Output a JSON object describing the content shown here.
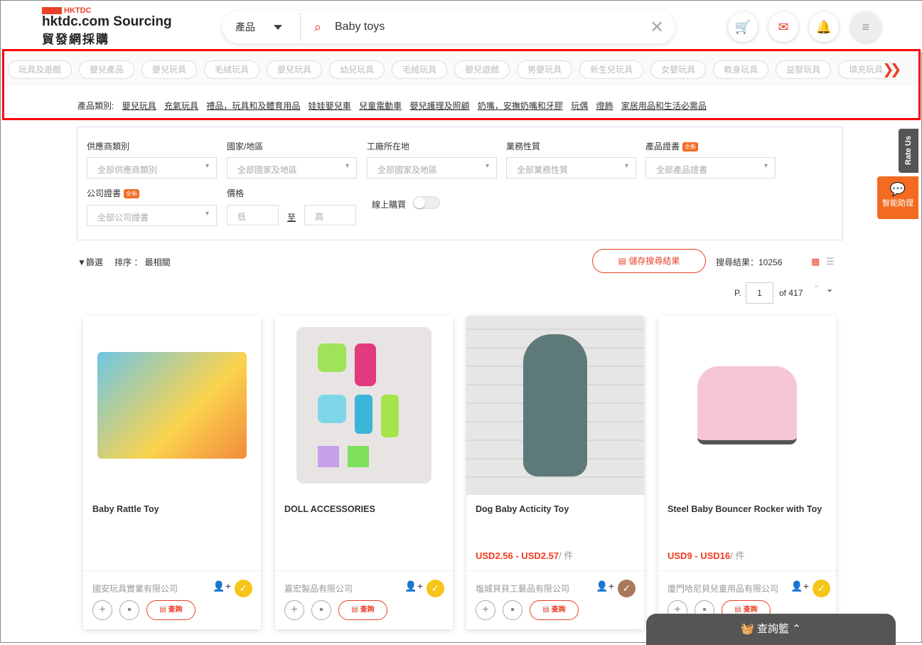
{
  "header": {
    "logo_brand": "HKTDC",
    "logo_line1": "hktdc.com Sourcing",
    "logo_line2": "貿發網採購",
    "search_category": "產品",
    "search_value": "Baby toys",
    "icons": [
      "cart-icon",
      "mail-icon",
      "bell-icon",
      "menu-icon"
    ]
  },
  "chips": [
    "玩具及遊戲",
    "嬰兒產品",
    "嬰兒玩具",
    "毛絨玩具",
    "嬰兒玩具",
    "幼兒玩具",
    "毛绒玩具",
    "嬰兒遊戲",
    "男嬰玩具",
    "新生兒玩具",
    "女嬰玩具",
    "軟身玩具",
    "益智玩具",
    "填充玩具"
  ],
  "categories": {
    "label": "產品類別:",
    "items": [
      "嬰兒玩具",
      "充氣玩具",
      "禮品，玩具和及體育用品",
      "娃娃嬰兒車",
      "兒童電動車",
      "嬰兒護理及照顧",
      "奶嘴，安撫奶嘴和牙膠",
      "玩偶",
      "燈飾",
      "家居用品和生活必需品"
    ]
  },
  "filters": {
    "new_badge": "全新",
    "supplier_type": {
      "label": "供應商類別",
      "value": "全部供應商類別"
    },
    "country": {
      "label": "國家/地區",
      "value": "全部國家及地區"
    },
    "factory": {
      "label": "工廠所在地",
      "value": "全部國家及地區"
    },
    "business": {
      "label": "業務性質",
      "value": "全部業務性質"
    },
    "product_cert": {
      "label": "產品證書",
      "value": "全部產品證書"
    },
    "company_cert": {
      "label": "公司證書",
      "value": "全部公司證書"
    },
    "price": {
      "label": "價格",
      "low": "低",
      "to": "至",
      "high": "高"
    },
    "online": {
      "label": "線上購買",
      "on": false
    }
  },
  "toolbar": {
    "filter": "篩選",
    "sort": "排序 ： 最相關",
    "save": "儲存搜尋結果",
    "results": "搜尋結果：10256",
    "page_prefix": "P.",
    "page": "1",
    "page_of": "of 417"
  },
  "products": [
    {
      "name": "Baby Rattle Toy",
      "price": "",
      "unit": "",
      "supplier": "國安玩具實業有限公司",
      "badge_color": "#f5c518"
    },
    {
      "name": "DOLL ACCESSORIES",
      "price": "",
      "unit": "",
      "supplier": "嘉宏製品有限公司",
      "badge_color": "#f5c518"
    },
    {
      "name": "Dog Baby Acticity Toy",
      "price": "USD2.56 - USD2.57",
      "unit": "/ 件",
      "supplier": "塩城貝貝工藝品有限公司",
      "badge_color": "#a9785a"
    },
    {
      "name": "Steel Baby Bouncer Rocker with Toy",
      "price": "USD9 - USD16",
      "unit": "/ 件",
      "supplier": "廈門哈尼貝兒童用品有限公司",
      "badge_color": "#f5c518"
    }
  ],
  "inquiry": "查詢",
  "side": {
    "rate": "Rate Us",
    "assistant": "智能助理"
  },
  "basket": "查詢籃"
}
